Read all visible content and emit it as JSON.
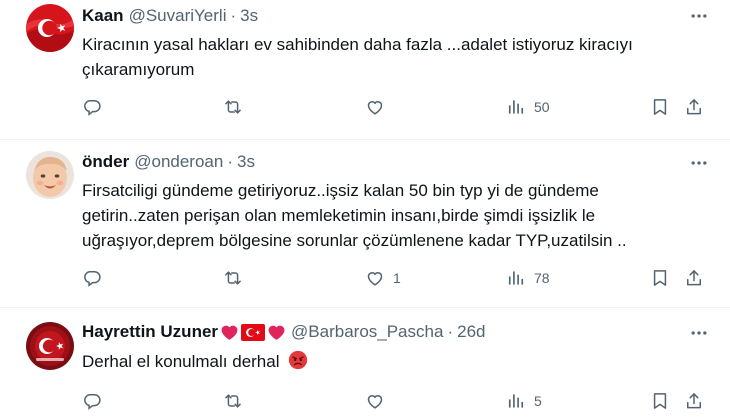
{
  "tweets": [
    {
      "name": "Kaan",
      "handle": "@SuvariYerli",
      "sep": "·",
      "time": "3s",
      "text_lines": [
        "Kiracının yasal hakları ev sahibinden daha fazla ...adalet istiyoruz kiracıyı",
        "çıkaramıyorum"
      ],
      "replies": "",
      "retweets": "",
      "likes": "",
      "views": "50"
    },
    {
      "name": "önder",
      "handle": "@onderoan",
      "sep": "·",
      "time": "3s",
      "text_lines": [
        "Firsatciligi gündeme getiriyoruz..işsiz kalan 50 bin typ yi de gündeme",
        "getirin..zaten perişan olan memleketimin insanı,birde şimdi işsizlik le",
        "uğraşıyor,deprem bölgesine sorunlar çözümlenene kadar TYP,uzatilsin .."
      ],
      "replies": "",
      "retweets": "",
      "likes": "1",
      "views": "78"
    },
    {
      "name": "Hayrettin Uzuner",
      "handle": "@Barbaros_Pascha",
      "sep": "·",
      "time": "26d",
      "text_lines": [
        "Derhal el konulmalı derhal"
      ],
      "replies": "",
      "retweets": "",
      "likes": "",
      "views": "5"
    }
  ],
  "icons": [
    "reply-icon",
    "retweet-icon",
    "like-icon",
    "views-icon",
    "bookmark-icon",
    "share-icon",
    "more-icon"
  ],
  "colors": {
    "text": "#0f1419",
    "secondary": "#536471",
    "divider": "#eff3f4",
    "heart_emoji": "#e0245e",
    "flag_red": "#e30a17"
  }
}
